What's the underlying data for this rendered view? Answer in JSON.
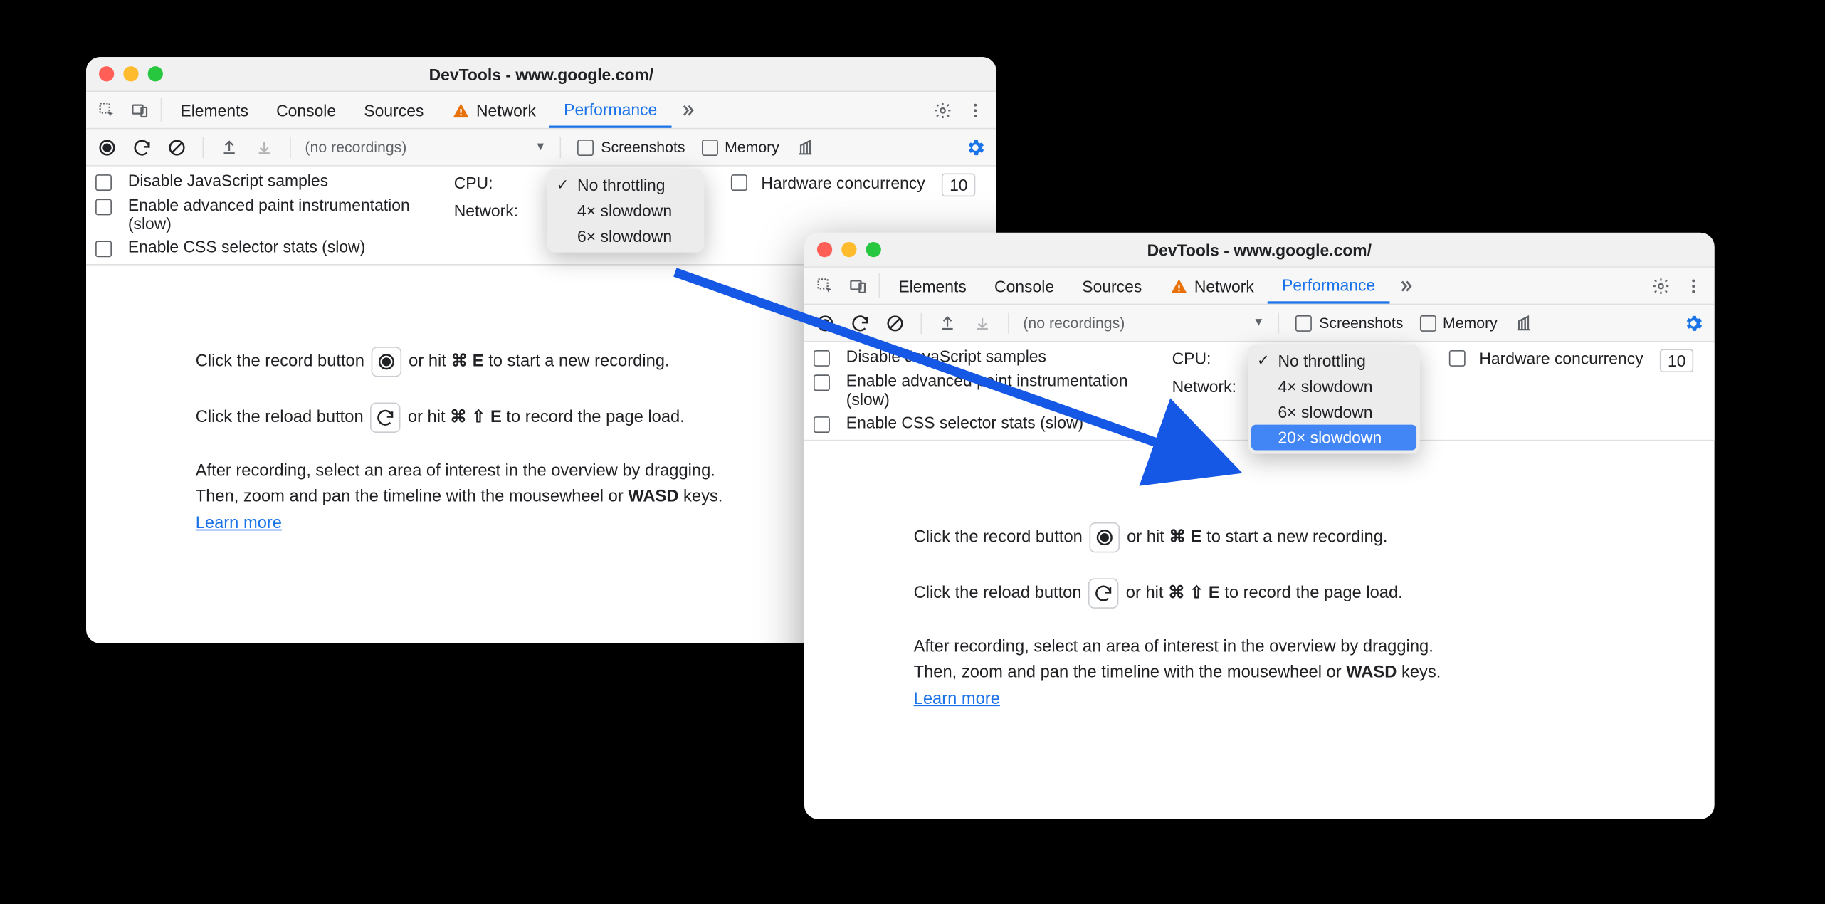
{
  "windowTitle": "DevTools - www.google.com/",
  "tabs": {
    "elements": "Elements",
    "console": "Console",
    "sources": "Sources",
    "network": "Network",
    "performance": "Performance"
  },
  "toolbar": {
    "noRecordings": "(no recordings)",
    "screenshots": "Screenshots",
    "memory": "Memory"
  },
  "settings": {
    "disableJS": "Disable JavaScript samples",
    "advPaint": "Enable advanced paint instrumentation (slow)",
    "cssStats": "Enable CSS selector stats (slow)",
    "cpuLabel": "CPU:",
    "networkLabel": "Network:",
    "hwConcurrency": "Hardware concurrency",
    "hwValue": "10"
  },
  "dropdownA": {
    "noThrottling": "No throttling",
    "slow4x": "4× slowdown",
    "slow6x": "6× slowdown"
  },
  "dropdownB": {
    "noThrottling": "No throttling",
    "slow4x": "4× slowdown",
    "slow6x": "6× slowdown",
    "slow20x": "20× slowdown"
  },
  "help": {
    "recordPrefix": "Click the record button ",
    "recordMid": " or hit ",
    "recordShortcut": "⌘ E",
    "recordSuffix": " to start a new recording.",
    "reloadPrefix": "Click the reload button ",
    "reloadMid": " or hit ",
    "reloadShortcut": "⌘ ⇧ E",
    "reloadSuffix": " to record the page load.",
    "after1": "After recording, select an area of interest in the overview by dragging.",
    "after2a": "Then, zoom and pan the timeline with the mousewheel or ",
    "after2bold": "WASD",
    "after2b": " keys.",
    "learnMore": "Learn more"
  }
}
